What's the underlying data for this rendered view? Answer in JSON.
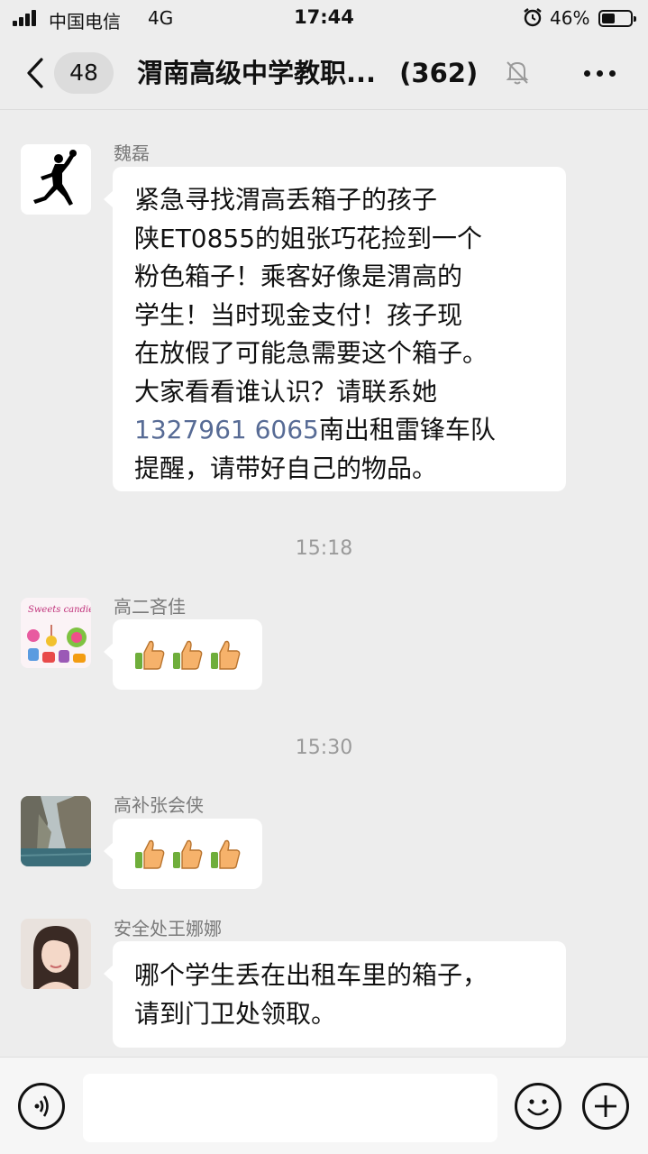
{
  "status_bar": {
    "carrier": "中国电信",
    "network": "4G",
    "time": "17:44",
    "battery_percent": "46%",
    "battery_level": 0.46,
    "icons": [
      "signal-icon",
      "alarm-icon",
      "battery-icon"
    ]
  },
  "nav": {
    "unread_count": "48",
    "title": "渭南高级中学教职...",
    "member_count": "(362)",
    "icons": [
      "back-chevron-icon",
      "mute-bell-icon",
      "more-icon"
    ]
  },
  "messages": [
    {
      "sender": "魏磊",
      "avatar": "jumpman-logo-avatar",
      "lines": [
        "紧急寻找渭高丢箱子的孩子",
        "陕ET0855的姐张巧花捡到一个",
        "粉色箱子！乘客好像是渭高的",
        "学生！当时现金支付！孩子现",
        "在放假了可能急需要这个箱子。",
        "大家看看谁认识？请联系她"
      ],
      "phone": "1327961 6065",
      "after_phone": "南出租雷锋车队",
      "last_line": "提醒，请带好自己的物品。"
    },
    {
      "timestamp": "15:18",
      "sender": "高二吝佳",
      "avatar": "sweets-candies-avatar",
      "emoji": "thumbs-up x3"
    },
    {
      "timestamp": "15:30",
      "sender": "高补张会侠",
      "avatar": "cliff-landscape-avatar",
      "emoji": "thumbs-up x3"
    },
    {
      "sender": "安全处王娜娜",
      "avatar": "woman-portrait-avatar",
      "lines": [
        "哪个学生丢在出租车里的箱子，",
        "请到门卫处领取。"
      ]
    }
  ],
  "avatar_texts": {
    "sweets": "Sweets candies"
  },
  "input_bar": {
    "placeholder": "",
    "icons": [
      "voice-icon",
      "emoji-icon",
      "plus-icon"
    ]
  },
  "colors": {
    "background": "#ededed",
    "bubble": "#ffffff",
    "link": "#576b95",
    "timestamp": "#9a9a9a"
  }
}
